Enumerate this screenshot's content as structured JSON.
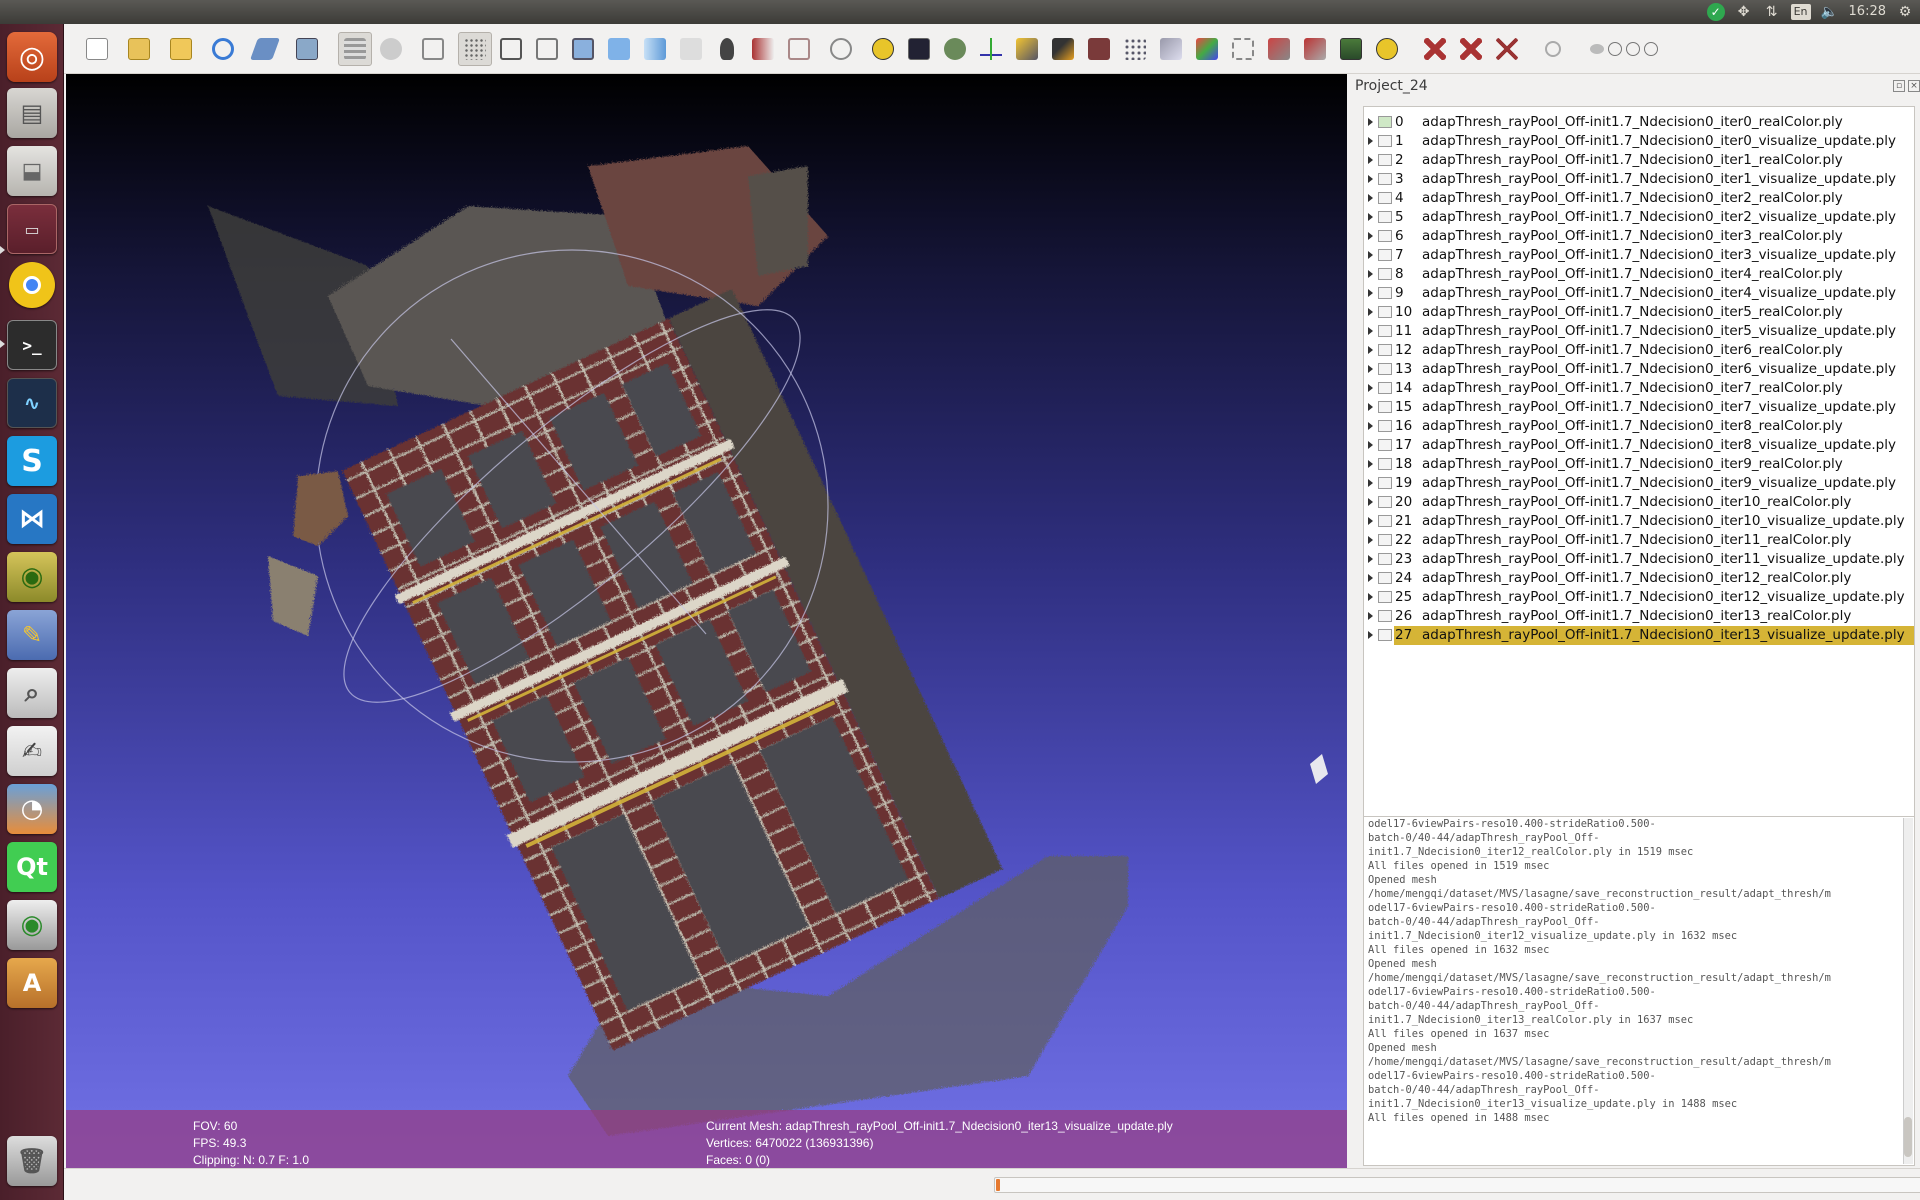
{
  "system_tray": {
    "time": "16:28",
    "lang": "En"
  },
  "panel": {
    "title": "Project_24"
  },
  "layers": [
    {
      "index": "0",
      "name": "adapThresh_rayPool_Off-init1.7_Ndecision0_iter0_realColor.ply",
      "visible": true,
      "selected": false
    },
    {
      "index": "1",
      "name": "adapThresh_rayPool_Off-init1.7_Ndecision0_iter0_visualize_update.ply",
      "visible": false,
      "selected": false
    },
    {
      "index": "2",
      "name": "adapThresh_rayPool_Off-init1.7_Ndecision0_iter1_realColor.ply",
      "visible": false,
      "selected": false
    },
    {
      "index": "3",
      "name": "adapThresh_rayPool_Off-init1.7_Ndecision0_iter1_visualize_update.ply",
      "visible": false,
      "selected": false
    },
    {
      "index": "4",
      "name": "adapThresh_rayPool_Off-init1.7_Ndecision0_iter2_realColor.ply",
      "visible": false,
      "selected": false
    },
    {
      "index": "5",
      "name": "adapThresh_rayPool_Off-init1.7_Ndecision0_iter2_visualize_update.ply",
      "visible": false,
      "selected": false
    },
    {
      "index": "6",
      "name": "adapThresh_rayPool_Off-init1.7_Ndecision0_iter3_realColor.ply",
      "visible": false,
      "selected": false
    },
    {
      "index": "7",
      "name": "adapThresh_rayPool_Off-init1.7_Ndecision0_iter3_visualize_update.ply",
      "visible": false,
      "selected": false
    },
    {
      "index": "8",
      "name": "adapThresh_rayPool_Off-init1.7_Ndecision0_iter4_realColor.ply",
      "visible": false,
      "selected": false
    },
    {
      "index": "9",
      "name": "adapThresh_rayPool_Off-init1.7_Ndecision0_iter4_visualize_update.ply",
      "visible": false,
      "selected": false
    },
    {
      "index": "10",
      "name": "adapThresh_rayPool_Off-init1.7_Ndecision0_iter5_realColor.ply",
      "visible": false,
      "selected": false
    },
    {
      "index": "11",
      "name": "adapThresh_rayPool_Off-init1.7_Ndecision0_iter5_visualize_update.ply",
      "visible": false,
      "selected": false
    },
    {
      "index": "12",
      "name": "adapThresh_rayPool_Off-init1.7_Ndecision0_iter6_realColor.ply",
      "visible": false,
      "selected": false
    },
    {
      "index": "13",
      "name": "adapThresh_rayPool_Off-init1.7_Ndecision0_iter6_visualize_update.ply",
      "visible": false,
      "selected": false
    },
    {
      "index": "14",
      "name": "adapThresh_rayPool_Off-init1.7_Ndecision0_iter7_realColor.ply",
      "visible": false,
      "selected": false
    },
    {
      "index": "15",
      "name": "adapThresh_rayPool_Off-init1.7_Ndecision0_iter7_visualize_update.ply",
      "visible": false,
      "selected": false
    },
    {
      "index": "16",
      "name": "adapThresh_rayPool_Off-init1.7_Ndecision0_iter8_realColor.ply",
      "visible": false,
      "selected": false
    },
    {
      "index": "17",
      "name": "adapThresh_rayPool_Off-init1.7_Ndecision0_iter8_visualize_update.ply",
      "visible": false,
      "selected": false
    },
    {
      "index": "18",
      "name": "adapThresh_rayPool_Off-init1.7_Ndecision0_iter9_realColor.ply",
      "visible": false,
      "selected": false
    },
    {
      "index": "19",
      "name": "adapThresh_rayPool_Off-init1.7_Ndecision0_iter9_visualize_update.ply",
      "visible": false,
      "selected": false
    },
    {
      "index": "20",
      "name": "adapThresh_rayPool_Off-init1.7_Ndecision0_iter10_realColor.ply",
      "visible": false,
      "selected": false
    },
    {
      "index": "21",
      "name": "adapThresh_rayPool_Off-init1.7_Ndecision0_iter10_visualize_update.ply",
      "visible": false,
      "selected": false
    },
    {
      "index": "22",
      "name": "adapThresh_rayPool_Off-init1.7_Ndecision0_iter11_realColor.ply",
      "visible": false,
      "selected": false
    },
    {
      "index": "23",
      "name": "adapThresh_rayPool_Off-init1.7_Ndecision0_iter11_visualize_update.ply",
      "visible": false,
      "selected": false
    },
    {
      "index": "24",
      "name": "adapThresh_rayPool_Off-init1.7_Ndecision0_iter12_realColor.ply",
      "visible": false,
      "selected": false
    },
    {
      "index": "25",
      "name": "adapThresh_rayPool_Off-init1.7_Ndecision0_iter12_visualize_update.ply",
      "visible": false,
      "selected": false
    },
    {
      "index": "26",
      "name": "adapThresh_rayPool_Off-init1.7_Ndecision0_iter13_realColor.ply",
      "visible": false,
      "selected": false
    },
    {
      "index": "27",
      "name": "adapThresh_rayPool_Off-init1.7_Ndecision0_iter13_visualize_update.ply",
      "visible": false,
      "selected": true
    }
  ],
  "log_text": "odel17-6viewPairs-reso10.400-strideRatio0.500-\nbatch-0/40-44/adapThresh_rayPool_Off-\ninit1.7_Ndecision0_iter12_realColor.ply in 1519 msec\nAll files opened in 1519 msec\nOpened mesh\n/home/mengqi/dataset/MVS/lasagne/save_reconstruction_result/adapt_thresh/m\nodel17-6viewPairs-reso10.400-strideRatio0.500-\nbatch-0/40-44/adapThresh_rayPool_Off-\ninit1.7_Ndecision0_iter12_visualize_update.ply in 1632 msec\nAll files opened in 1632 msec\nOpened mesh\n/home/mengqi/dataset/MVS/lasagne/save_reconstruction_result/adapt_thresh/m\nodel17-6viewPairs-reso10.400-strideRatio0.500-\nbatch-0/40-44/adapThresh_rayPool_Off-\ninit1.7_Ndecision0_iter13_realColor.ply in 1637 msec\nAll files opened in 1637 msec\nOpened mesh\n/home/mengqi/dataset/MVS/lasagne/save_reconstruction_result/adapt_thresh/m\nodel17-6viewPairs-reso10.400-strideRatio0.500-\nbatch-0/40-44/adapThresh_rayPool_Off-\ninit1.7_Ndecision0_iter13_visualize_update.ply in 1488 msec\nAll files opened in 1488 msec",
  "info": {
    "fov": "FOV: 60",
    "fps": "FPS:    49.3",
    "clipping": "Clipping: N:    0.7 F:    1.0",
    "current_mesh": "Current Mesh: adapThresh_rayPool_Off-init1.7_Ndecision0_iter13_visualize_update.ply",
    "vertices": "Vertices: 6470022 (136931396)",
    "faces": "Faces: 0 (0)"
  },
  "progress": 0.0,
  "launcher_icons": [
    "ubuntu-dash-icon",
    "files-icon",
    "drive-icon",
    "folder-icon",
    "chrome-icon",
    "terminal-icon",
    "system-monitor-icon",
    "skype-icon",
    "vscode-icon",
    "nvidia-icon",
    "qt-designer-icon",
    "image-viewer-icon",
    "text-editor-icon",
    "blender-icon",
    "qt-creator-icon",
    "eye-icon",
    "software-center-icon",
    "trash-icon"
  ],
  "colors": {
    "selection": "#d5b436",
    "info_overlay": "#963c82"
  }
}
